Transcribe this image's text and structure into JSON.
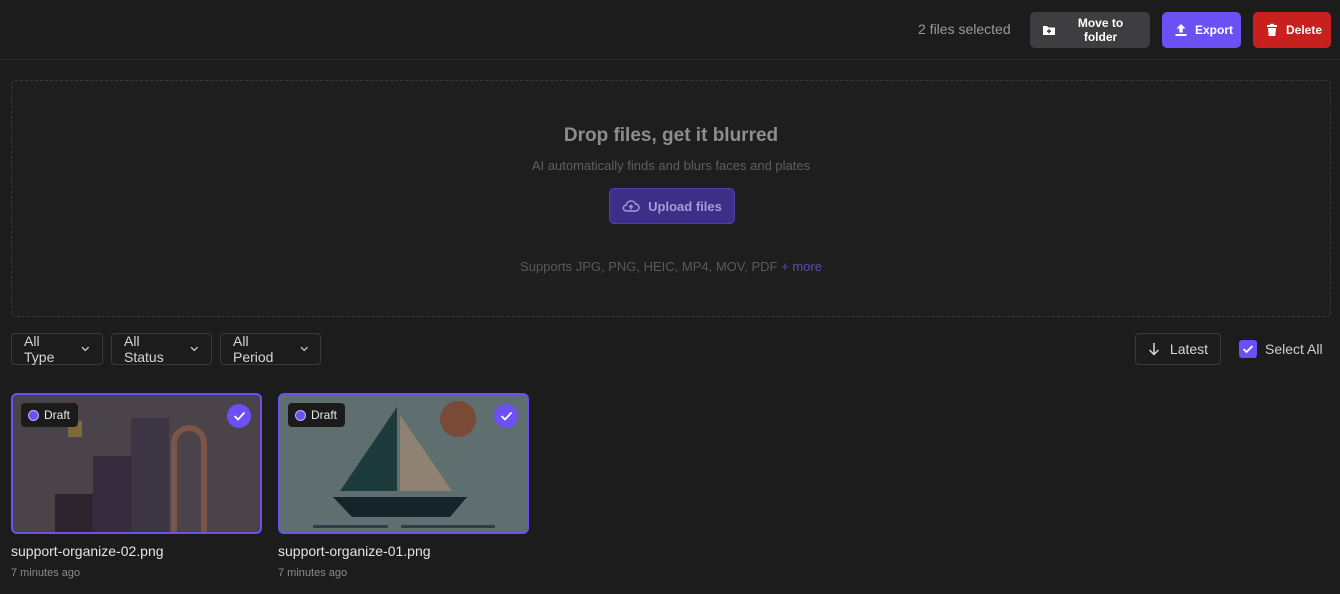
{
  "toolbar": {
    "selection_text": "2 files selected",
    "move_label": "Move to folder",
    "export_label": "Export",
    "delete_label": "Delete"
  },
  "dropzone": {
    "title": "Drop files, get it blurred",
    "subtitle": "AI automatically finds and blurs faces and plates",
    "upload_label": "Upload files",
    "supports_text": "Supports JPG, PNG, HEIC, MP4, MOV, PDF",
    "more_link": "+ more"
  },
  "filters": {
    "type": "All Type",
    "status": "All Status",
    "period": "All Period",
    "sort": "Latest",
    "select_all": "Select All",
    "select_all_checked": true
  },
  "files": [
    {
      "name": "support-organize-02.png",
      "time": "7 minutes ago",
      "status": "Draft",
      "selected": true
    },
    {
      "name": "support-organize-01.png",
      "time": "7 minutes ago",
      "status": "Draft",
      "selected": true
    }
  ],
  "colors": {
    "accent": "#6b51f5",
    "danger": "#c8201f",
    "background": "#1c1c1d"
  },
  "icons": [
    "folder-plus-icon",
    "upload-icon",
    "trash-icon",
    "cloud-upload-icon",
    "chevron-down-icon",
    "arrow-down-icon",
    "check-icon"
  ]
}
